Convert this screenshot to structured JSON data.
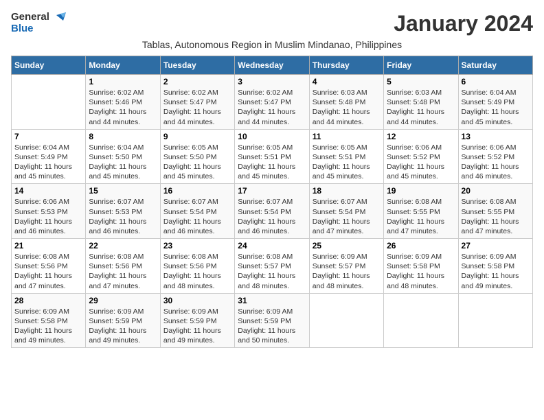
{
  "logo": {
    "line1": "General",
    "line2": "Blue"
  },
  "title": "January 2024",
  "subtitle": "Tablas, Autonomous Region in Muslim Mindanao, Philippines",
  "days_of_week": [
    "Sunday",
    "Monday",
    "Tuesday",
    "Wednesday",
    "Thursday",
    "Friday",
    "Saturday"
  ],
  "weeks": [
    [
      {
        "day": "",
        "info": ""
      },
      {
        "day": "1",
        "info": "Sunrise: 6:02 AM\nSunset: 5:46 PM\nDaylight: 11 hours\nand 44 minutes."
      },
      {
        "day": "2",
        "info": "Sunrise: 6:02 AM\nSunset: 5:47 PM\nDaylight: 11 hours\nand 44 minutes."
      },
      {
        "day": "3",
        "info": "Sunrise: 6:02 AM\nSunset: 5:47 PM\nDaylight: 11 hours\nand 44 minutes."
      },
      {
        "day": "4",
        "info": "Sunrise: 6:03 AM\nSunset: 5:48 PM\nDaylight: 11 hours\nand 44 minutes."
      },
      {
        "day": "5",
        "info": "Sunrise: 6:03 AM\nSunset: 5:48 PM\nDaylight: 11 hours\nand 44 minutes."
      },
      {
        "day": "6",
        "info": "Sunrise: 6:04 AM\nSunset: 5:49 PM\nDaylight: 11 hours\nand 45 minutes."
      }
    ],
    [
      {
        "day": "7",
        "info": "Sunrise: 6:04 AM\nSunset: 5:49 PM\nDaylight: 11 hours\nand 45 minutes."
      },
      {
        "day": "8",
        "info": "Sunrise: 6:04 AM\nSunset: 5:50 PM\nDaylight: 11 hours\nand 45 minutes."
      },
      {
        "day": "9",
        "info": "Sunrise: 6:05 AM\nSunset: 5:50 PM\nDaylight: 11 hours\nand 45 minutes."
      },
      {
        "day": "10",
        "info": "Sunrise: 6:05 AM\nSunset: 5:51 PM\nDaylight: 11 hours\nand 45 minutes."
      },
      {
        "day": "11",
        "info": "Sunrise: 6:05 AM\nSunset: 5:51 PM\nDaylight: 11 hours\nand 45 minutes."
      },
      {
        "day": "12",
        "info": "Sunrise: 6:06 AM\nSunset: 5:52 PM\nDaylight: 11 hours\nand 45 minutes."
      },
      {
        "day": "13",
        "info": "Sunrise: 6:06 AM\nSunset: 5:52 PM\nDaylight: 11 hours\nand 46 minutes."
      }
    ],
    [
      {
        "day": "14",
        "info": "Sunrise: 6:06 AM\nSunset: 5:53 PM\nDaylight: 11 hours\nand 46 minutes."
      },
      {
        "day": "15",
        "info": "Sunrise: 6:07 AM\nSunset: 5:53 PM\nDaylight: 11 hours\nand 46 minutes."
      },
      {
        "day": "16",
        "info": "Sunrise: 6:07 AM\nSunset: 5:54 PM\nDaylight: 11 hours\nand 46 minutes."
      },
      {
        "day": "17",
        "info": "Sunrise: 6:07 AM\nSunset: 5:54 PM\nDaylight: 11 hours\nand 46 minutes."
      },
      {
        "day": "18",
        "info": "Sunrise: 6:07 AM\nSunset: 5:54 PM\nDaylight: 11 hours\nand 47 minutes."
      },
      {
        "day": "19",
        "info": "Sunrise: 6:08 AM\nSunset: 5:55 PM\nDaylight: 11 hours\nand 47 minutes."
      },
      {
        "day": "20",
        "info": "Sunrise: 6:08 AM\nSunset: 5:55 PM\nDaylight: 11 hours\nand 47 minutes."
      }
    ],
    [
      {
        "day": "21",
        "info": "Sunrise: 6:08 AM\nSunset: 5:56 PM\nDaylight: 11 hours\nand 47 minutes."
      },
      {
        "day": "22",
        "info": "Sunrise: 6:08 AM\nSunset: 5:56 PM\nDaylight: 11 hours\nand 47 minutes."
      },
      {
        "day": "23",
        "info": "Sunrise: 6:08 AM\nSunset: 5:56 PM\nDaylight: 11 hours\nand 48 minutes."
      },
      {
        "day": "24",
        "info": "Sunrise: 6:08 AM\nSunset: 5:57 PM\nDaylight: 11 hours\nand 48 minutes."
      },
      {
        "day": "25",
        "info": "Sunrise: 6:09 AM\nSunset: 5:57 PM\nDaylight: 11 hours\nand 48 minutes."
      },
      {
        "day": "26",
        "info": "Sunrise: 6:09 AM\nSunset: 5:58 PM\nDaylight: 11 hours\nand 48 minutes."
      },
      {
        "day": "27",
        "info": "Sunrise: 6:09 AM\nSunset: 5:58 PM\nDaylight: 11 hours\nand 49 minutes."
      }
    ],
    [
      {
        "day": "28",
        "info": "Sunrise: 6:09 AM\nSunset: 5:58 PM\nDaylight: 11 hours\nand 49 minutes."
      },
      {
        "day": "29",
        "info": "Sunrise: 6:09 AM\nSunset: 5:59 PM\nDaylight: 11 hours\nand 49 minutes."
      },
      {
        "day": "30",
        "info": "Sunrise: 6:09 AM\nSunset: 5:59 PM\nDaylight: 11 hours\nand 49 minutes."
      },
      {
        "day": "31",
        "info": "Sunrise: 6:09 AM\nSunset: 5:59 PM\nDaylight: 11 hours\nand 50 minutes."
      },
      {
        "day": "",
        "info": ""
      },
      {
        "day": "",
        "info": ""
      },
      {
        "day": "",
        "info": ""
      }
    ]
  ]
}
